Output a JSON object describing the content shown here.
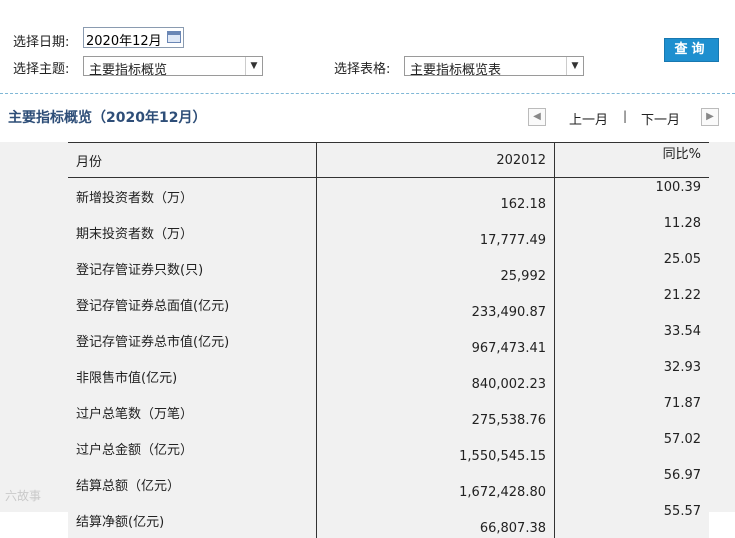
{
  "filters": {
    "date_label": "选择日期:",
    "date_value": "2020年12月",
    "theme_label": "选择主题:",
    "theme_value": "主要指标概览",
    "table_label": "选择表格:",
    "table_value": "主要指标概览表",
    "query_button": "查询"
  },
  "section": {
    "title": "主要指标概览（2020年12月）",
    "prev_label": "上一月",
    "separator": "|",
    "next_label": "下一月"
  },
  "table": {
    "headers": [
      "月份",
      "202012",
      "同比%"
    ],
    "rows": [
      {
        "name": "新增投资者数（万）",
        "value": "162.18",
        "yoy": "100.39"
      },
      {
        "name": "期末投资者数（万）",
        "value": "17,777.49",
        "yoy": "11.28"
      },
      {
        "name": "登记存管证券只数(只)",
        "value": "25,992",
        "yoy": "25.05"
      },
      {
        "name": "登记存管证券总面值(亿元)",
        "value": "233,490.87",
        "yoy": "21.22"
      },
      {
        "name": "登记存管证券总市值(亿元)",
        "value": "967,473.41",
        "yoy": "33.54"
      },
      {
        "name": "非限售市值(亿元)",
        "value": "840,002.23",
        "yoy": "32.93"
      },
      {
        "name": "过户总笔数（万笔）",
        "value": "275,538.76",
        "yoy": "71.87"
      },
      {
        "name": "过户总金额（亿元）",
        "value": "1,550,545.15",
        "yoy": "57.02"
      },
      {
        "name": "结算总额（亿元）",
        "value": "1,672,428.80",
        "yoy": "56.97"
      },
      {
        "name": "结算净额(亿元)",
        "value": "66,807.38",
        "yoy": "55.57"
      }
    ]
  },
  "watermark": "六故事"
}
